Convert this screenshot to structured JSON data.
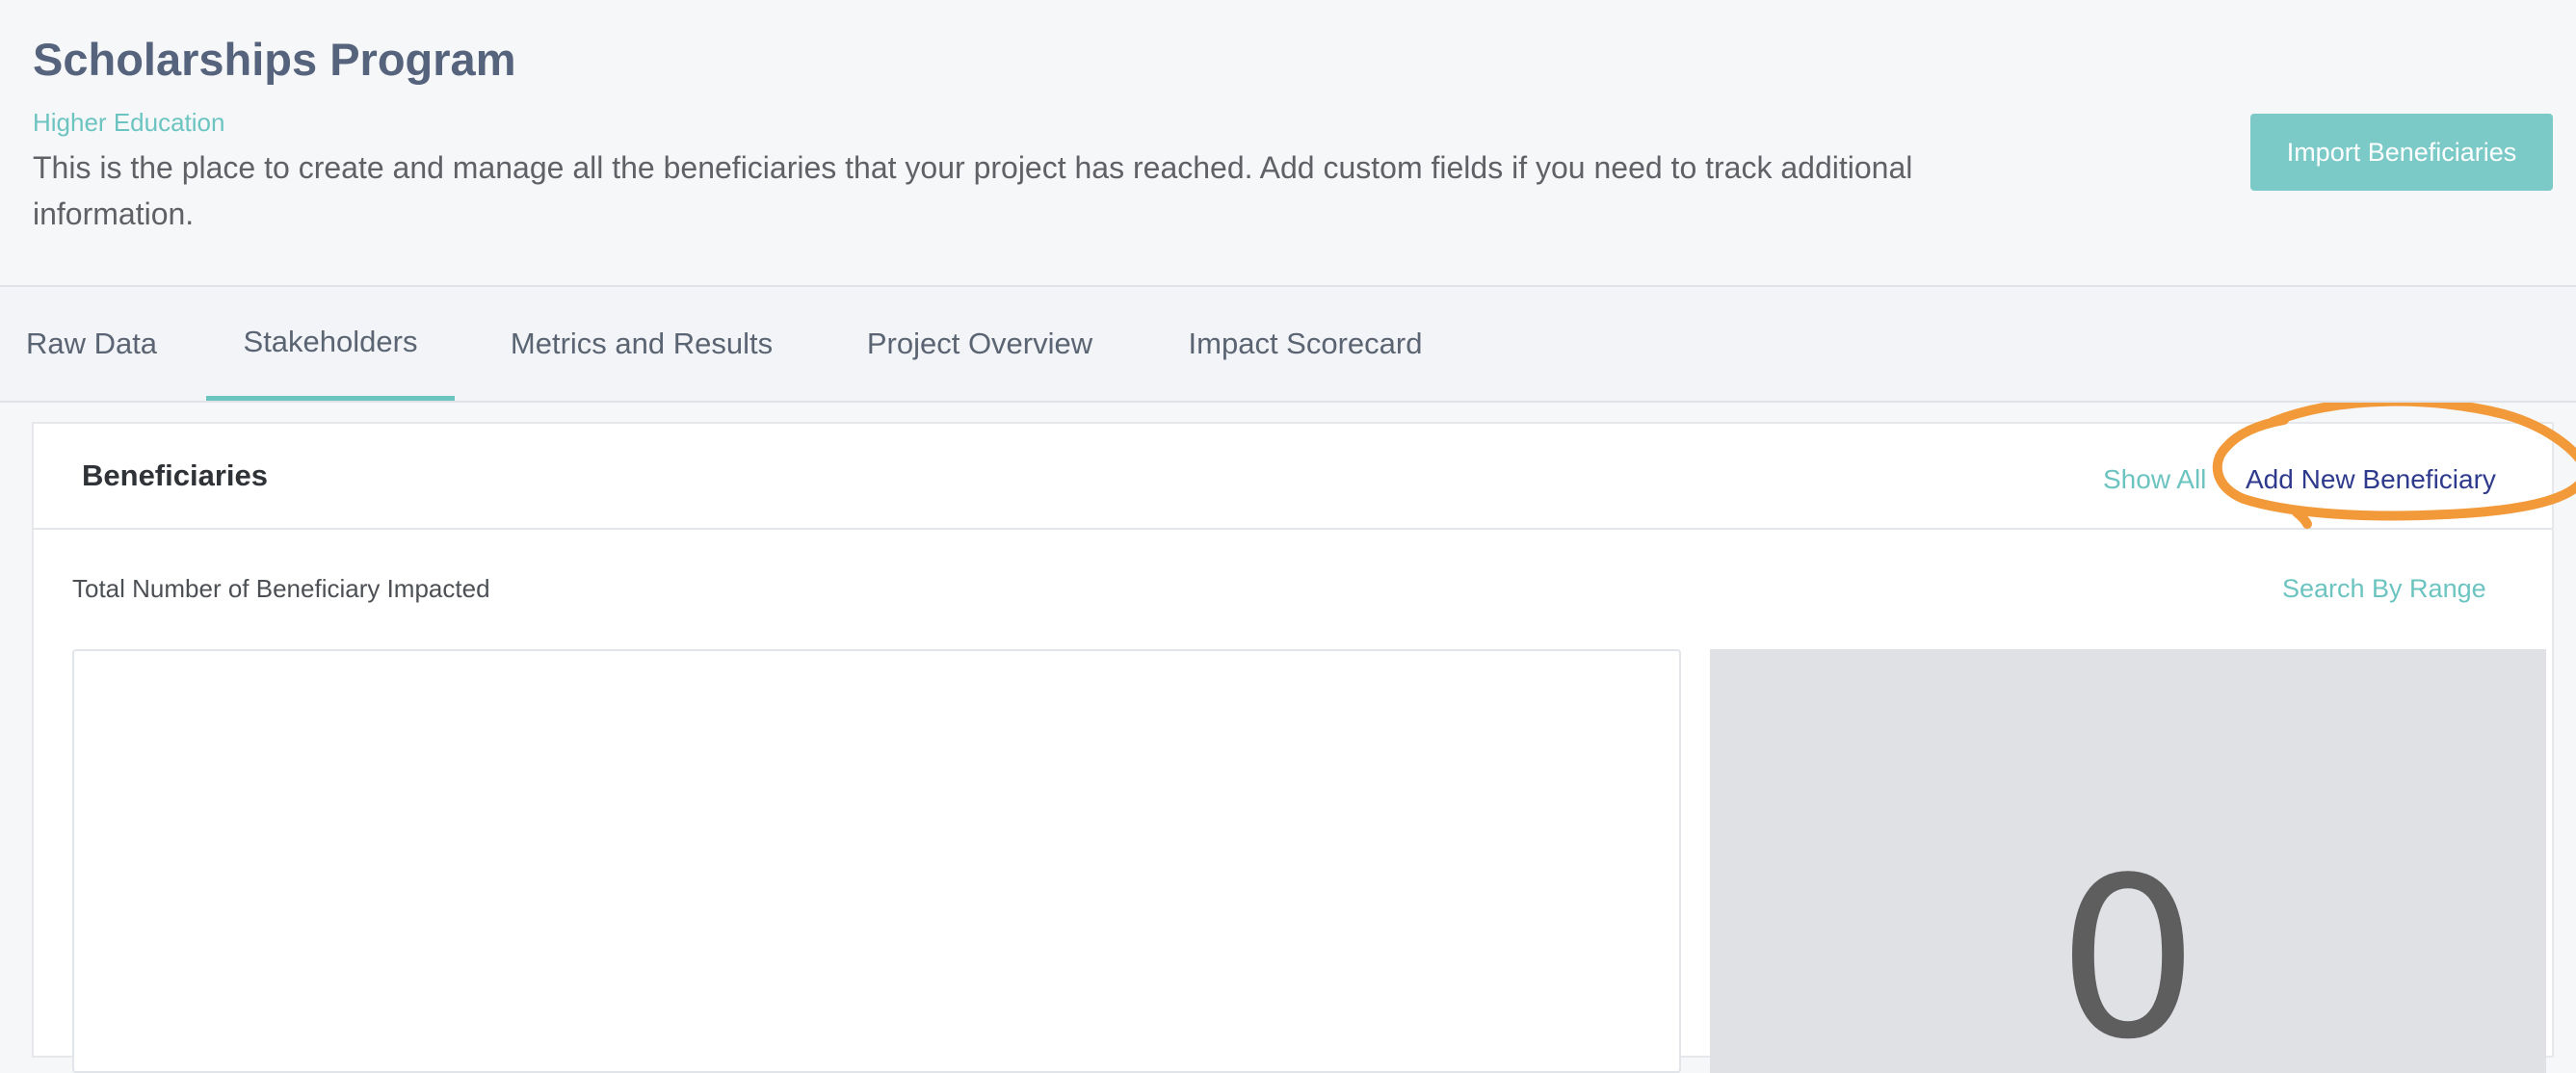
{
  "header": {
    "title": "Scholarships Program",
    "subtitle": "Higher Education",
    "description": "This is the place to create and manage all the beneficiaries that your project has reached. Add custom fields if you need to track additional information.",
    "import_label": "Import Beneficiaries"
  },
  "tabs": [
    {
      "label": "Raw Data",
      "active": false
    },
    {
      "label": "Stakeholders",
      "active": true
    },
    {
      "label": "Metrics and Results",
      "active": false
    },
    {
      "label": "Project Overview",
      "active": false
    },
    {
      "label": "Impact Scorecard",
      "active": false
    }
  ],
  "card": {
    "title": "Beneficiaries",
    "show_all_label": "Show All",
    "add_new_label": "Add New Beneficiary",
    "metric_label": "Total Number of Beneficiary Impacted",
    "search_range_label": "Search By Range",
    "count_value": "0"
  },
  "colors": {
    "accent": "#6cc4c1",
    "button_bg": "#7ccac7",
    "title": "#56637c",
    "link_dark": "#2e3a8c",
    "highlight": "#f29a3a"
  }
}
